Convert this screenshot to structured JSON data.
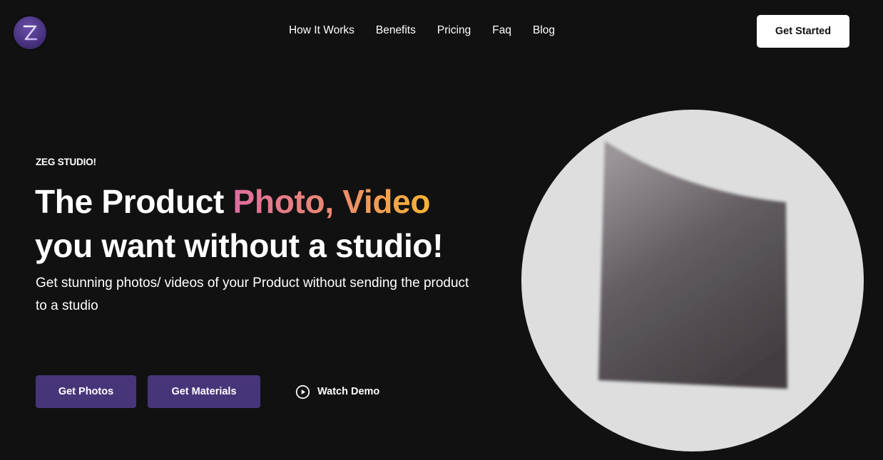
{
  "header": {
    "logo": {
      "letter": "Z",
      "icon": "z-logo-icon",
      "color": "#4a3482"
    },
    "nav": [
      {
        "label": "How It Works"
      },
      {
        "label": "Benefits"
      },
      {
        "label": "Pricing"
      },
      {
        "label": "Faq"
      },
      {
        "label": "Blog"
      }
    ],
    "cta_label": "Get Started"
  },
  "hero": {
    "eyebrow": "ZEG STUDIO!",
    "headline": {
      "part1": "The Product ",
      "highlight": "Photo, Video",
      "line2": "you want without a studio!"
    },
    "subtitle": "Get stunning photos/ videos of your Product without sending the product to a studio",
    "buttons": {
      "photos": "Get Photos",
      "materials": "Get Materials",
      "watch_demo": "Watch Demo",
      "watch_icon": "play-circle-icon"
    },
    "media": {
      "description": "blurred dark product panel on light grey circular background"
    }
  },
  "colors": {
    "background": "#111111",
    "primary_button": "#47357a",
    "gradient": [
      "#de6d9f",
      "#ec8970",
      "#f6b434"
    ],
    "media_bg": "#dedede"
  }
}
